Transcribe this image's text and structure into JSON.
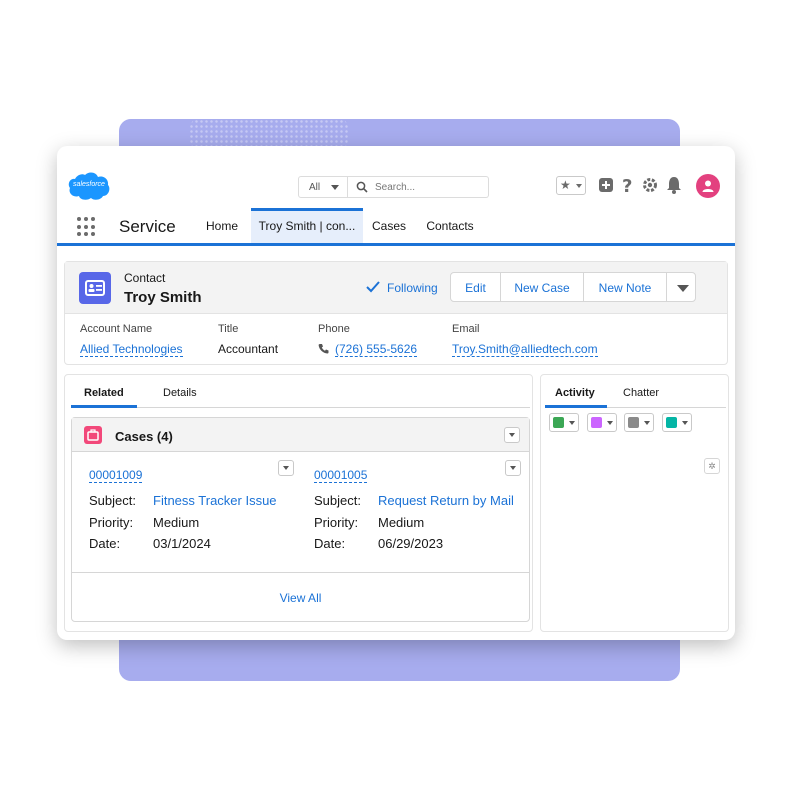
{
  "logo": {
    "text": "salesforce",
    "color": "#1b96ff"
  },
  "search": {
    "scope": "All",
    "placeholder": "Search..."
  },
  "header_icons": [
    "favorites-icon",
    "add-icon",
    "help-icon",
    "setup-gear-icon",
    "notifications-bell-icon",
    "user-avatar-icon"
  ],
  "nav": {
    "app_name": "Service",
    "items": [
      {
        "label": "Home",
        "active": false
      },
      {
        "label": "Troy Smith | con...",
        "active": true
      },
      {
        "label": "Cases",
        "active": false
      },
      {
        "label": "Contacts",
        "active": false
      }
    ]
  },
  "contact": {
    "type": "Contact",
    "name": "Troy Smith",
    "following_label": "Following",
    "actions": [
      "Edit",
      "New Case",
      "New Note"
    ],
    "fields": [
      {
        "label": "Account Name",
        "value": "Allied Technologies",
        "link": true
      },
      {
        "label": "Title",
        "value": "Accountant",
        "link": false
      },
      {
        "label": "Phone",
        "value": "(726) 555-5626",
        "link": true
      },
      {
        "label": "Email",
        "value": "Troy.Smith@alliedtech.com",
        "link": true
      }
    ]
  },
  "related": {
    "tabs": [
      "Related",
      "Details"
    ],
    "cases_title": "Cases (4)",
    "field_labels": {
      "subject": "Subject:",
      "priority": "Priority:",
      "date": "Date:"
    },
    "cases": [
      {
        "number": "00001009",
        "subject": "Fitness Tracker Issue",
        "priority": "Medium",
        "date": "03/1/2024"
      },
      {
        "number": "00001005",
        "subject": "Request Return by Mail",
        "priority": "Medium",
        "date": "06/29/2023"
      }
    ],
    "view_all": "View All"
  },
  "activity": {
    "tabs": [
      "Activity",
      "Chatter"
    ],
    "buttons": [
      {
        "name": "log-call",
        "color": "#3ba755"
      },
      {
        "name": "new-event",
        "color": "#cb65ff"
      },
      {
        "name": "email",
        "color": "#8a8a8a"
      },
      {
        "name": "new-task",
        "color": "#04b5a5"
      }
    ]
  }
}
